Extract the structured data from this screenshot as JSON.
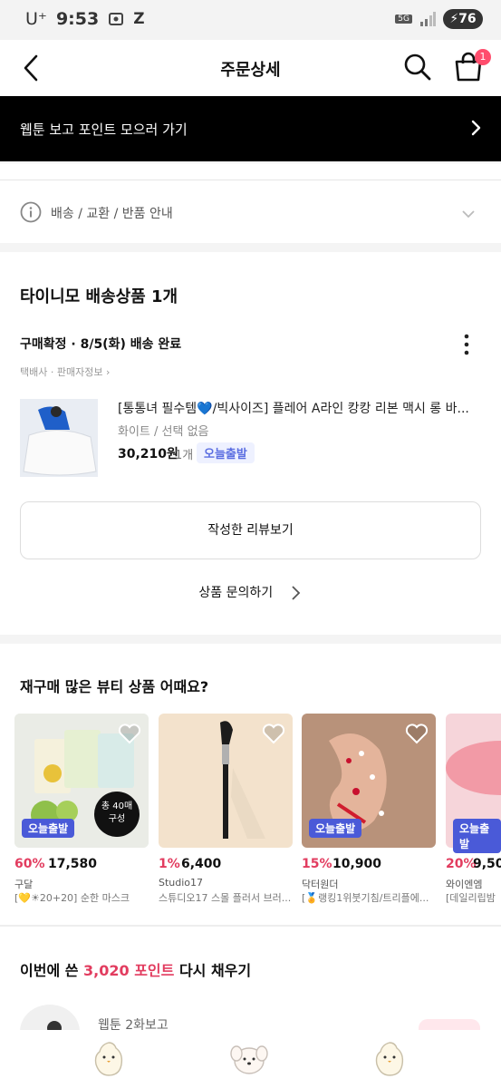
{
  "status_bar": {
    "time": "9:53",
    "carrier": "U⁺",
    "network": "5G",
    "battery": "76"
  },
  "header": {
    "title": "주문상세",
    "cart_count": "1"
  },
  "banner": {
    "text": "웹툰 보고 포인트 모으러 가기"
  },
  "shipping_info": {
    "label": "배송 / 교환 / 반품 안내"
  },
  "order": {
    "section_title": "타이니모 배송상품 1개",
    "status": "구매확정 · 8/5(화) 배송 완료",
    "carrier_info": "택배사 · 판매자정보 ›",
    "product": {
      "name": "[통통녀 필수템💙/빅사이즈] 플레어 A라인 캉캉 리본 맥시 롱 바...",
      "option": "화이트 / 선택 없음",
      "price": "30,210원",
      "qty": "1개",
      "badge": "오늘출발"
    },
    "review_button": "작성한 리뷰보기",
    "inquiry_button": "상품 문의하기"
  },
  "recommend": {
    "title": "재구매 많은 뷰티 상품 어때요?",
    "items": [
      {
        "discount": "60%",
        "price": "17,580",
        "brand": "구달",
        "desc": "[💛☀20+20] 순한 마스크",
        "badge": "오늘출발",
        "count_line1": "총 40매",
        "count_line2": "구성"
      },
      {
        "discount": "1%",
        "price": "6,400",
        "brand": "Studio17",
        "desc": "스튜디오17 스몰 플러서 브러...",
        "badge": ""
      },
      {
        "discount": "15%",
        "price": "10,900",
        "brand": "닥터원더",
        "desc": "[🏅랭킹1위붓기침/트리플에...",
        "badge": "오늘출발"
      },
      {
        "discount": "20%",
        "price": "9,50",
        "brand": "와이엔엠",
        "desc": "[데일리립밤",
        "badge": "오늘출발"
      }
    ]
  },
  "refill": {
    "prefix": "이번에 쓴 ",
    "points": "3,020 포인트",
    "suffix": " 다시 채우기",
    "webtoon_label": "웹툰 2화보고"
  },
  "colors": {
    "accent_pink": "#e23c5f",
    "today_badge": "#4a5ad8",
    "banner_bg": "#000000"
  }
}
